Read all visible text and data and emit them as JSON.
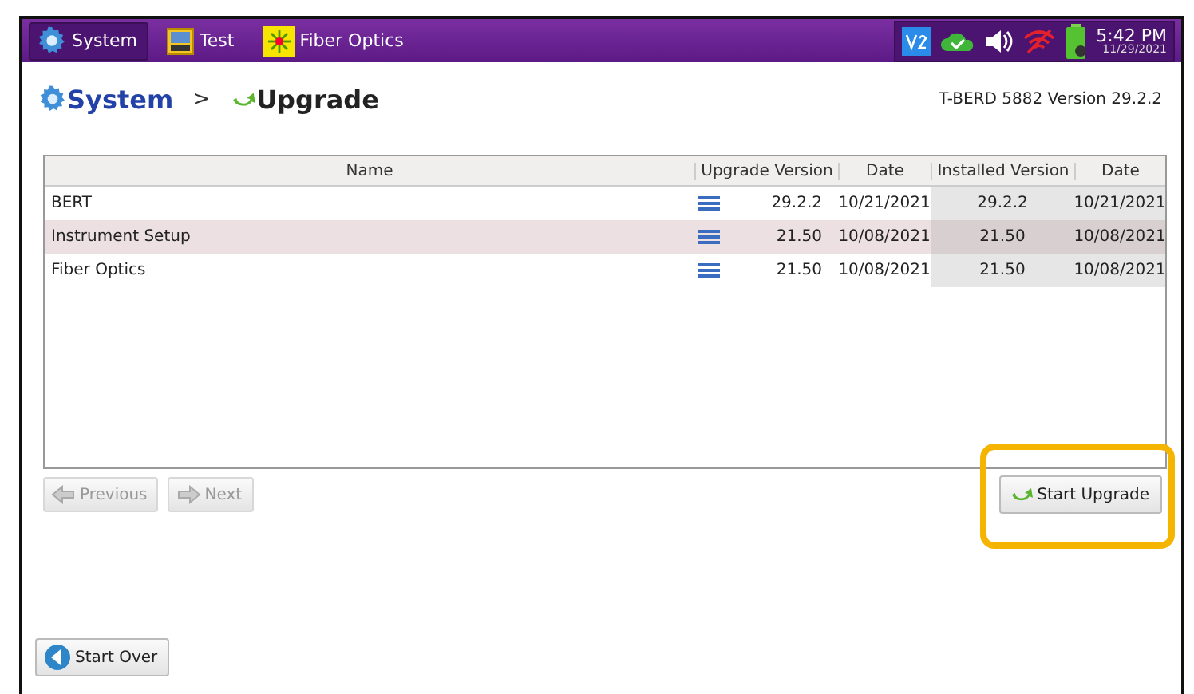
{
  "top_tabs": [
    {
      "label": "System",
      "kind": "gear",
      "selected": true
    },
    {
      "label": "Test",
      "kind": "bert",
      "selected": false
    },
    {
      "label": "Fiber Optics",
      "kind": "laser",
      "selected": false
    }
  ],
  "status": {
    "time": "5:42 PM",
    "date": "11/29/2021"
  },
  "breadcrumb": {
    "root": "System",
    "separator": ">",
    "current": "Upgrade"
  },
  "version_label": "T-BERD 5882 Version 29.2.2",
  "table": {
    "columns": [
      "Name",
      "Upgrade Version",
      "Date",
      "Installed Version",
      "Date"
    ],
    "rows": [
      {
        "name": "BERT",
        "upgrade_version": "29.2.2",
        "upgrade_date": "10/21/2021",
        "installed_version": "29.2.2",
        "installed_date": "10/21/2021",
        "selected": false
      },
      {
        "name": "Instrument Setup",
        "upgrade_version": "21.50",
        "upgrade_date": "10/08/2021",
        "installed_version": "21.50",
        "installed_date": "10/08/2021",
        "selected": true
      },
      {
        "name": "Fiber Optics",
        "upgrade_version": "21.50",
        "upgrade_date": "10/08/2021",
        "installed_version": "21.50",
        "installed_date": "10/08/2021",
        "selected": false
      }
    ]
  },
  "pager": [
    {
      "label": "Previous",
      "kind": "prev",
      "disabled": true
    },
    {
      "label": "Next",
      "kind": "next",
      "disabled": true
    }
  ],
  "start_upgrade": {
    "label": "Start Upgrade",
    "highlighted": true
  },
  "start_over": {
    "label": "Start Over"
  }
}
